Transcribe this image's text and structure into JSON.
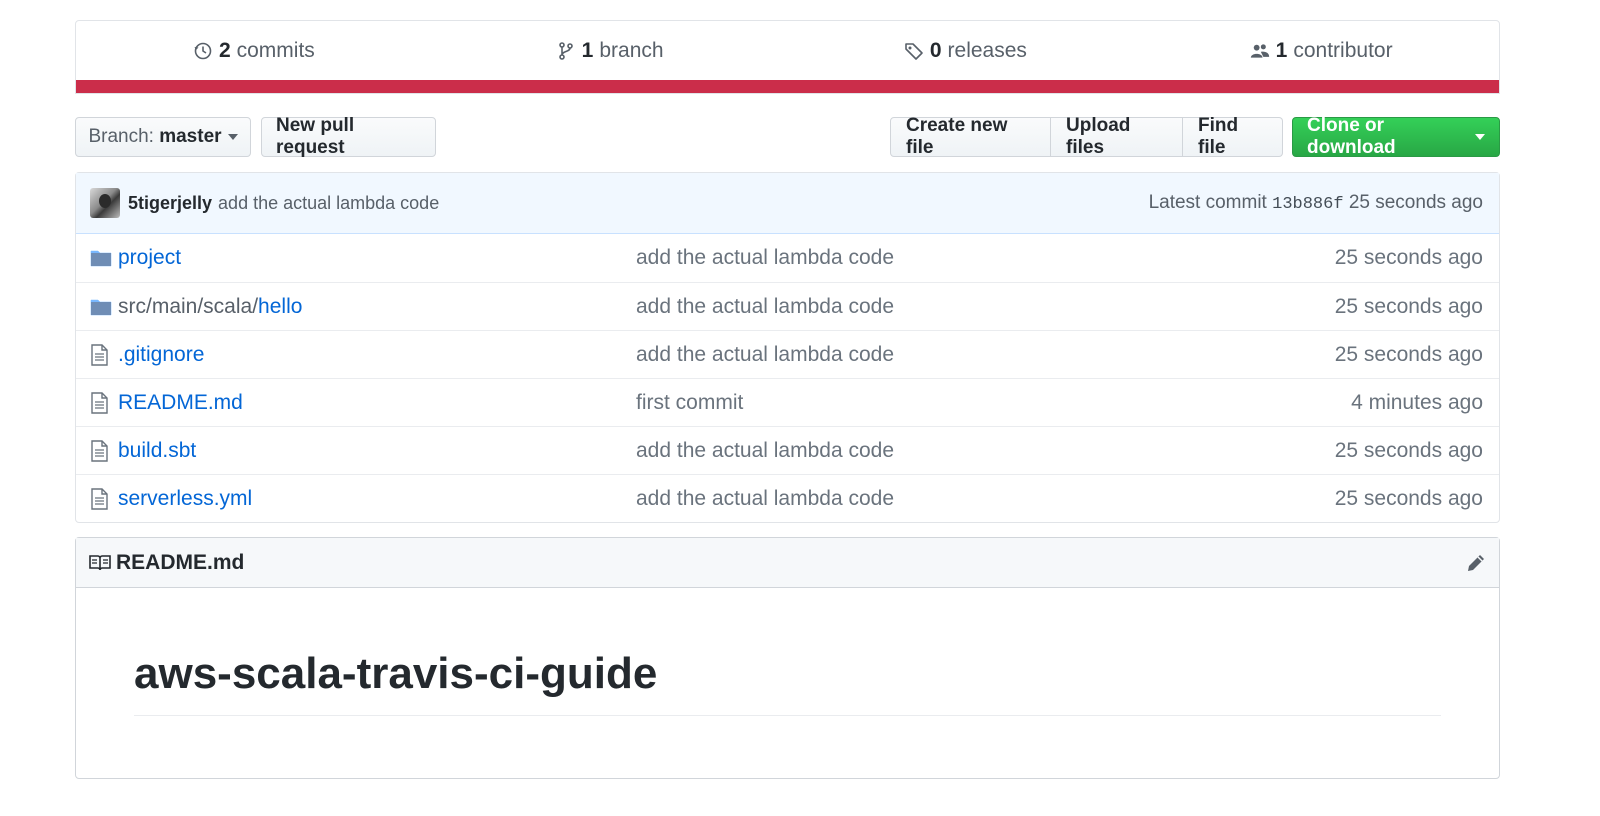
{
  "summary": {
    "commits": {
      "count": "2",
      "label": "commits"
    },
    "branches": {
      "count": "1",
      "label": "branch"
    },
    "releases": {
      "count": "0",
      "label": "releases"
    },
    "contributors": {
      "count": "1",
      "label": "contributor"
    },
    "language_bar_color": "#cb2d4a"
  },
  "toolbar": {
    "branch_prefix": "Branch:",
    "branch_name": "master",
    "new_pull_request": "New pull request",
    "create_new_file": "Create new file",
    "upload_files": "Upload files",
    "find_file": "Find file",
    "clone_or_download": "Clone or download"
  },
  "commit": {
    "author": "5tigerjelly",
    "message": "add the actual lambda code",
    "latest_label": "Latest commit",
    "sha": "13b886f",
    "age": "25 seconds ago"
  },
  "files": [
    {
      "type": "folder",
      "path_prefix": "",
      "name": "project",
      "message": "add the actual lambda code",
      "age": "25 seconds ago"
    },
    {
      "type": "folder",
      "path_prefix": "src/main/scala/",
      "name": "hello",
      "message": "add the actual lambda code",
      "age": "25 seconds ago"
    },
    {
      "type": "file",
      "path_prefix": "",
      "name": ".gitignore",
      "message": "add the actual lambda code",
      "age": "25 seconds ago"
    },
    {
      "type": "file",
      "path_prefix": "",
      "name": "README.md",
      "message": "first commit",
      "age": "4 minutes ago"
    },
    {
      "type": "file",
      "path_prefix": "",
      "name": "build.sbt",
      "message": "add the actual lambda code",
      "age": "25 seconds ago"
    },
    {
      "type": "file",
      "path_prefix": "",
      "name": "serverless.yml",
      "message": "add the actual lambda code",
      "age": "25 seconds ago"
    }
  ],
  "readme": {
    "filename": "README.md",
    "heading": "aws-scala-travis-ci-guide"
  }
}
